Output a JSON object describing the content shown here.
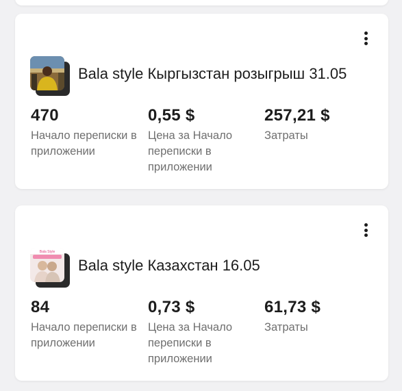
{
  "campaigns": [
    {
      "title": "Bala style Кыргызстан розыгрыш 31.05",
      "metrics": [
        {
          "value": "470",
          "label": "Начало переписки в приложении"
        },
        {
          "value": "0,55 $",
          "label": "Цена за Начало переписки в приложении"
        },
        {
          "value": "257,21 $",
          "label": "Затраты"
        }
      ]
    },
    {
      "title": "Bala style Казахстан 16.05",
      "thumb_text": "Bala Style",
      "metrics": [
        {
          "value": "84",
          "label": "Начало переписки в приложении"
        },
        {
          "value": "0,73 $",
          "label": "Цена за Начало переписки в приложении"
        },
        {
          "value": "61,73 $",
          "label": "Затраты"
        }
      ]
    }
  ],
  "icons": {
    "more": "more-vertical-icon"
  }
}
